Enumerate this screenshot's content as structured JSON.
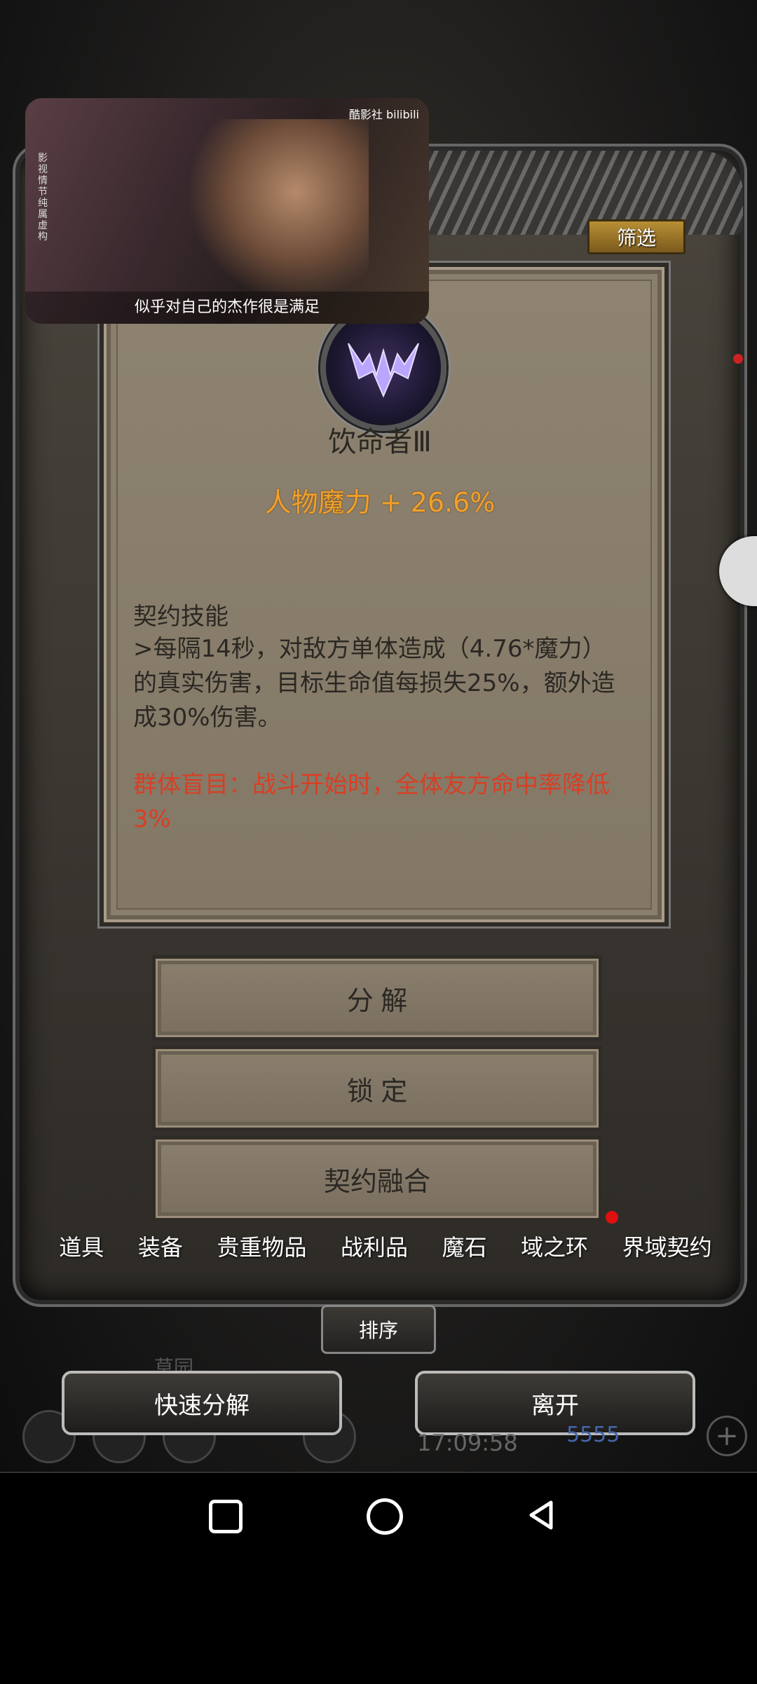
{
  "video": {
    "watermark": "酷影社 bilibili",
    "side_text": "影视情节 纯属虚构",
    "subtitle": "似乎对自己的杰作很是满足"
  },
  "filter_label": "筛选",
  "item": {
    "name": "饮命者Ⅲ",
    "stat": "人物魔力 + 26.6%",
    "skill_title": "契约技能",
    "skill_desc": ">每隔14秒，对敌方单体造成（4.76*魔力）的真实伤害，目标生命值每损失25%，额外造成30%伤害。",
    "group_desc": "群体盲目：战斗开始时，全体友方命中率降低3%"
  },
  "actions": {
    "decompose": "分 解",
    "lock": "锁 定",
    "fuse": "契约融合"
  },
  "tabs": [
    "道具",
    "装备",
    "贵重物品",
    "战利品",
    "魔石",
    "域之环",
    "界域契约"
  ],
  "sort_label": "排序",
  "quick_decompose": "快速分解",
  "leave": "离开",
  "status": {
    "clock": "17:09:58",
    "gems": "5555",
    "dim_label": "草园"
  },
  "colors": {
    "stat": "#f0a12b",
    "group_desc": "#d83f25",
    "filter_bg": "#b98f35"
  }
}
